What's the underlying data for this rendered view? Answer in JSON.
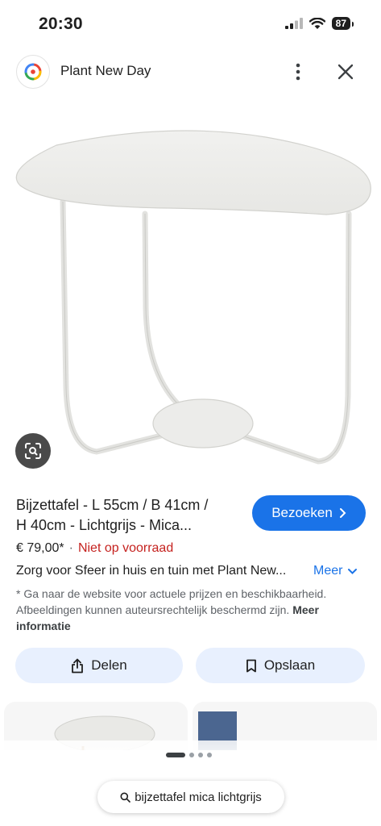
{
  "status_bar": {
    "time": "20:30",
    "battery": "87"
  },
  "header": {
    "site_name": "Plant New Day"
  },
  "product": {
    "title_line1": "Bijzettafel - L 55cm / B 41cm /",
    "title_line2": "H 40cm - Lichtgrijs - Mica...",
    "visit_label": "Bezoeken",
    "price": "€ 79,00*",
    "price_sep": "·",
    "stock": "Niet op voorraad",
    "description": "Zorg voor Sfeer in huis en tuin met Plant New...",
    "more_label": "Meer",
    "disclaimer": "* Ga naar de website voor actuele prijzen en beschikbaarheid. Afbeeldingen kunnen auteursrechtelijk beschermd zijn.",
    "more_info": "Meer informatie"
  },
  "actions": {
    "share_label": "Delen",
    "save_label": "Opslaan"
  },
  "search": {
    "query": "bijzettafel mica lichtgrijs"
  },
  "colors": {
    "accent": "#1a73e8",
    "stock_red": "#c5221f",
    "chip_bg": "#e8f0fe"
  },
  "icons": [
    "signal-icon",
    "wifi-icon",
    "battery-icon",
    "google-lens-logo-icon",
    "more-vert-icon",
    "close-icon",
    "lens-search-icon",
    "chevron-right-icon",
    "chevron-down-icon",
    "share-icon",
    "bookmark-icon",
    "search-icon"
  ]
}
